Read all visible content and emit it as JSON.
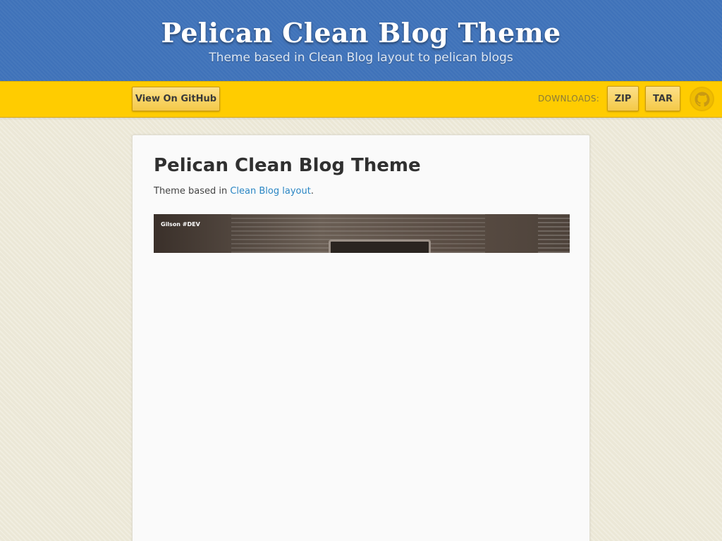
{
  "header": {
    "title": "Pelican Clean Blog Theme",
    "tagline": "Theme based in Clean Blog layout to pelican blogs"
  },
  "toolbar": {
    "github_button": "View On GitHub",
    "downloads_label": "DOWNLOADS:",
    "zip_button": "ZIP",
    "tar_button": "TAR",
    "github_icon": "github-octocat-icon"
  },
  "content": {
    "title": "Pelican Clean Blog Theme",
    "description_prefix": "Theme based in ",
    "description_link": "Clean Blog layout",
    "description_suffix": ".",
    "preview_brand": "Gilson #DEV"
  },
  "colors": {
    "header_bg": "#3f72b9",
    "toolbar_bg": "#ffcc00",
    "page_bg": "#ebe7d6",
    "link": "#2a86c4"
  }
}
